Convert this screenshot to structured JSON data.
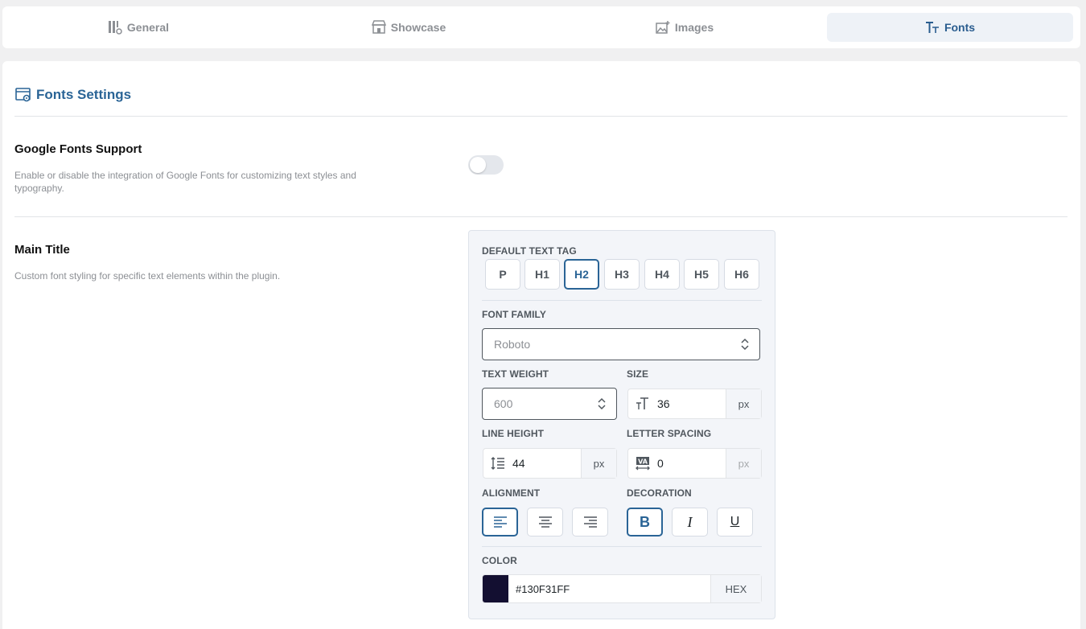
{
  "tabs": [
    {
      "label": "General",
      "icon": "general-icon"
    },
    {
      "label": "Showcase",
      "icon": "showcase-icon"
    },
    {
      "label": "Images",
      "icon": "images-icon"
    },
    {
      "label": "Fonts",
      "icon": "fonts-icon",
      "active": true
    }
  ],
  "section": {
    "title": "Fonts Settings",
    "icon": "settings-window-icon"
  },
  "google_fonts": {
    "title": "Google Fonts Support",
    "description": "Enable or disable the integration of Google Fonts for customizing text styles and typography.",
    "enabled": false
  },
  "main_title": {
    "title": "Main Title",
    "description": "Custom font styling for specific text elements within the plugin.",
    "default_tag_label": "DEFAULT TEXT TAG",
    "tags": [
      "P",
      "H1",
      "H2",
      "H3",
      "H4",
      "H5",
      "H6"
    ],
    "selected_tag": "H2",
    "font_family_label": "FONT FAMILY",
    "font_family": "Roboto",
    "text_weight_label": "TEXT WEIGHT",
    "text_weight": "600",
    "size_label": "SIZE",
    "size": "36",
    "size_unit": "px",
    "line_height_label": "LINE HEIGHT",
    "line_height": "44",
    "line_height_unit": "px",
    "letter_spacing_label": "LETTER SPACING",
    "letter_spacing": "0",
    "letter_spacing_unit": "px",
    "alignment_label": "ALIGNMENT",
    "alignment": "left",
    "decoration_label": "DECORATION",
    "decorations": [
      "B",
      "I",
      "U"
    ],
    "active_decoration": "B",
    "color_label": "COLOR",
    "color": "#130F31FF",
    "color_format": "HEX"
  },
  "colors": {
    "accent": "#2a6496",
    "swatch": "#130F31"
  }
}
